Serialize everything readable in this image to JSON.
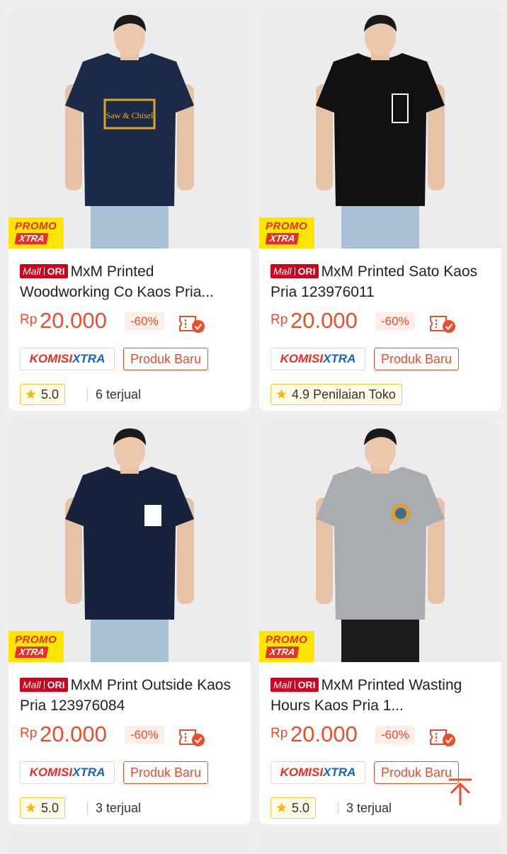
{
  "products": [
    {
      "name": "MxM Printed Woodworking Co Kaos Pria...",
      "mall_badge": [
        "Mall",
        "ORI"
      ],
      "promo": [
        "PROMO",
        "XTRA"
      ],
      "price_currency": "Rp",
      "price_amount": "20.000",
      "discount": "-60%",
      "komisi": [
        "KOMISI",
        "XTRA"
      ],
      "tag": "Produk Baru",
      "rating": "5.0",
      "sold": "6 terjual",
      "shirt_color": "#1b2a48",
      "print": "Saw & Chisel"
    },
    {
      "name": "MxM Printed Sato Kaos Pria 123976011",
      "mall_badge": [
        "Mall",
        "ORI"
      ],
      "promo": [
        "PROMO",
        "XTRA"
      ],
      "price_currency": "Rp",
      "price_amount": "20.000",
      "discount": "-60%",
      "komisi": [
        "KOMISI",
        "XTRA"
      ],
      "tag": "Produk Baru",
      "rating": "4.9 Penilaian Toko",
      "sold": "",
      "shirt_color": "#111111",
      "print": ""
    },
    {
      "name": "MxM Print Outside Kaos Pria 123976084",
      "mall_badge": [
        "Mall",
        "ORI"
      ],
      "promo": [
        "PROMO",
        "XTRA"
      ],
      "price_currency": "Rp",
      "price_amount": "20.000",
      "discount": "-60%",
      "komisi": [
        "KOMISI",
        "XTRA"
      ],
      "tag": "Produk Baru",
      "rating": "5.0",
      "sold": "3 terjual",
      "shirt_color": "#17223c",
      "print": ""
    },
    {
      "name": "MxM Printed Wasting Hours Kaos Pria 1...",
      "mall_badge": [
        "Mall",
        "ORI"
      ],
      "promo": [
        "PROMO",
        "XTRA"
      ],
      "price_currency": "Rp",
      "price_amount": "20.000",
      "discount": "-60%",
      "komisi": [
        "KOMISI",
        "XTRA"
      ],
      "tag": "Produk Baru",
      "rating": "5.0",
      "sold": "3 terjual",
      "shirt_color": "#a9acb0",
      "print": ""
    }
  ],
  "colors": {
    "price": "#ee4d2d",
    "mall_badge": "#d0011b",
    "promo_yellow": "#ffe500",
    "star": "#ffb400"
  },
  "icons": [
    "star-icon",
    "voucher-icon",
    "back-to-top-icon"
  ]
}
